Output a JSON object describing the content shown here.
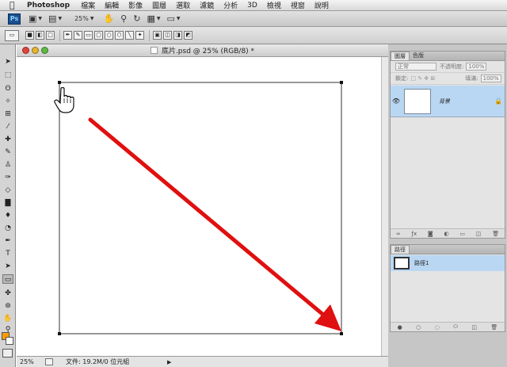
{
  "menubar": {
    "app_name": "Photoshop",
    "items": [
      "檔案",
      "編輯",
      "影像",
      "圖層",
      "選取",
      "濾鏡",
      "分析",
      "3D",
      "檢視",
      "視窗",
      "說明"
    ]
  },
  "appbar": {
    "logo": "Ps",
    "zoom": "25%"
  },
  "document": {
    "title": "底片.psd @ 25% (RGB/8) *",
    "zoom_status": "25%",
    "doc_info": "文件: 19.2M/0 位元組"
  },
  "layers_panel": {
    "tabs": [
      "圖層",
      "色版"
    ],
    "blend_mode": "正常",
    "opacity_label": "不透明度:",
    "opacity_value": "100%",
    "lock_label": "鎖定:",
    "fill_label": "填滿:",
    "fill_value": "100%",
    "layer_name": "背景"
  },
  "paths_panel": {
    "tab": "路徑",
    "path_name": "路徑1"
  },
  "colors": {
    "foreground": "#ff9c00",
    "arrow": "#e01010",
    "selection_row": "#b9d7f3"
  },
  "icons": [
    "apple-icon",
    "hand-icon",
    "zoom-icon",
    "rotate-view-icon",
    "eye-icon",
    "lock-icon",
    "pointer-hand-cursor-icon",
    "arrow-annotation"
  ]
}
